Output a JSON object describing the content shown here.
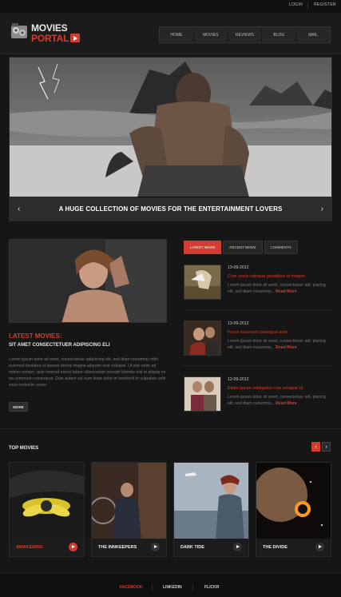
{
  "topbar": {
    "login": "LOGIN",
    "register": "REGISTER"
  },
  "logo": {
    "line1": "MOVIES",
    "line2": "PORTAL"
  },
  "nav": [
    "HOME",
    "MOVIES",
    "REVIEWS",
    "BLOG",
    "MAIL"
  ],
  "slider": {
    "caption": "A HUGE COLLECTION OF MOVIES FOR THE ENTERTAINMENT LOVERS",
    "prev": "‹",
    "next": "›"
  },
  "about": {
    "title": "LATEST MOVIES:",
    "subtitle": "SIT AMET CONSECTETUER ADIPISCING ELI",
    "text": "Lorem ipsum dolor sit amet, consectetuer adipiscing elit, sed diam nonummy nibh euismod tincidunt ut laoreet dolore magna aliquam erat volutpat. Ut wisi enim ad minim veniam, quis nostrud exerci tation ullamcorper suscipit lobortis nisl ut aliquip ex ea commodo consequat. Duis autem vel eum iriure dolor in hendrerit in vulputate velit esse molestie conse",
    "more": "MORE"
  },
  "tabs": [
    "LATEST NEWS",
    "RECENT NEWS",
    "COMMENTS"
  ],
  "news": [
    {
      "date": "13-09-2012",
      "title": "Cum sociis natoque penatibus et magnis",
      "text": "Lorem ipsum dolor sit amet, consectetuer adi- piscing elit, sed diam nonummy...",
      "more": "Read More"
    },
    {
      "date": "13-09-2012",
      "title": "Fusce euismod consequat ante",
      "text": "Lorem ipsum dolor sit amet, consectetuer adi- piscing elit, sed diam nonummy...",
      "more": "Read More"
    },
    {
      "date": "12-09-2012",
      "title": "Lorem ipsum dolor sit amet, consectetuer adi- piscing elit, sed diam nonummy...",
      "title_only": "Etiam ipsum volutpates cula volutpat sit",
      "text": "Lorem ipsum dolor sit amet, consectetuer adi- piscing elit, sed diam nonummy...",
      "more": "Read More"
    }
  ],
  "top_movies": {
    "title": "TOP MOVIES",
    "prev": "‹",
    "next": "›",
    "items": [
      "AWAKENING",
      "THE INNKEEPERS",
      "DARK TIDE",
      "THE DIVIDE"
    ]
  },
  "footer": [
    "FACEBOOK",
    "LINKEDIN",
    "FLICKR"
  ],
  "colors": {
    "accent": "#d33c2e",
    "background": "#161616"
  }
}
